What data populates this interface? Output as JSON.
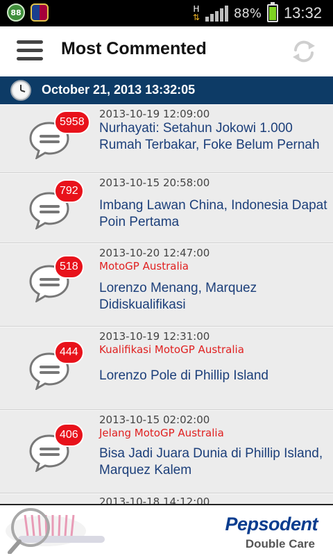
{
  "status_bar": {
    "notification_badge": "88",
    "network_type": "H",
    "battery_percent": "88%",
    "battery_level": 0.88,
    "time": "13:32",
    "icons": [
      "notification-badge-icon",
      "club-crest-icon",
      "data-arrows-icon",
      "signal-icon",
      "battery-icon"
    ]
  },
  "header": {
    "title": "Most Commented",
    "menu_icon": "hamburger-icon",
    "refresh_icon": "refresh-icon"
  },
  "datebar": {
    "text": "October 21, 2013  13:32:05",
    "icon": "clock-icon"
  },
  "articles": [
    {
      "count": "5958",
      "date": "2013-10-19 12:09:00",
      "subtitle": "",
      "title": "Nurhayati: Setahun Jokowi 1.000 Rumah Terbakar, Foke Belum Pernah"
    },
    {
      "count": "792",
      "date": "2013-10-15 20:58:00",
      "subtitle": "",
      "title": "Imbang Lawan China, Indonesia Dapat Poin Pertama"
    },
    {
      "count": "518",
      "date": "2013-10-20 12:47:00",
      "subtitle": "MotoGP Australia",
      "title": "Lorenzo Menang, Marquez Didiskualifikasi"
    },
    {
      "count": "444",
      "date": "2013-10-19 12:31:00",
      "subtitle": "Kualifikasi MotoGP Australia",
      "title": "Lorenzo Pole di Phillip Island"
    },
    {
      "count": "406",
      "date": "2013-10-15 02:02:00",
      "subtitle": "Jelang MotoGP Australia",
      "title": "Bisa Jadi Juara Dunia di Phillip Island, Marquez Kalem"
    },
    {
      "count": "",
      "date": "2013-10-18 14:12:00",
      "subtitle": "",
      "title": ""
    }
  ],
  "ad": {
    "brand": "Pepsodent",
    "tagline": "Double Care"
  },
  "colors": {
    "date_bar": "#0d3b66",
    "badge": "#e8121b",
    "title_text": "#1c3f7a",
    "subtitle_text": "#e02020"
  }
}
